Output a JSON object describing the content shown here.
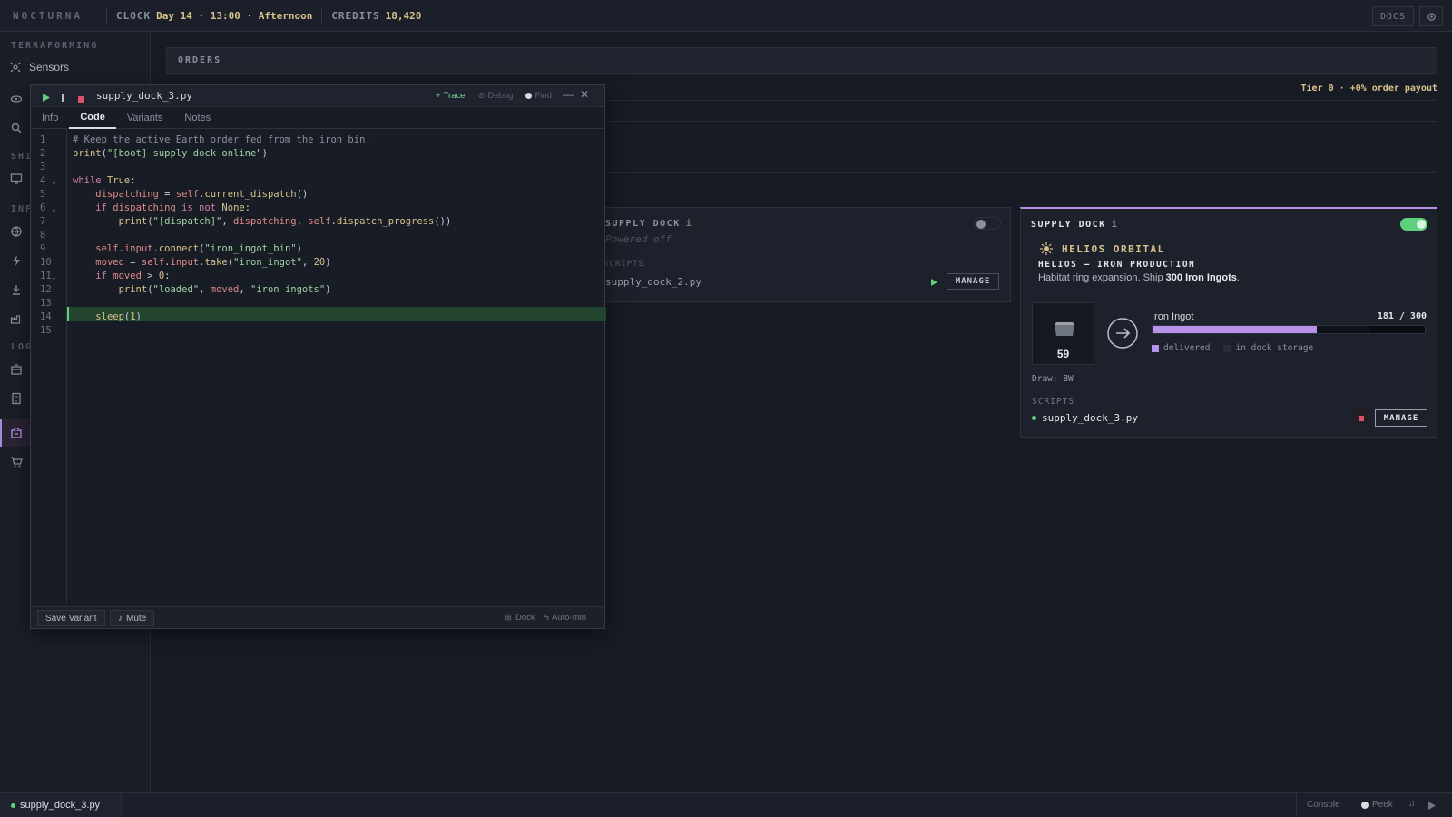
{
  "topbar": {
    "brand": "NOCTURNA",
    "clock_label": "CLOCK",
    "clock_value": "Day 14 · 13:00 · Afternoon",
    "credits_label": "CREDITS",
    "credits_value": "18,420",
    "docs_label": "DOCS",
    "settings_icon": "gear-icon"
  },
  "sidebar": {
    "section_terraforming": "TERRAFORMING",
    "sensors_label": "Sensors",
    "section_shi": "SHI",
    "section_inf": "INF",
    "section_log": "LOG"
  },
  "main": {
    "orders_title": "ORDERS",
    "tier_text": "Tier 0 · +0% order payout"
  },
  "dock_left": {
    "title": "SUPPLY DOCK",
    "status": "Powered off",
    "scripts_label": "SCRIPTS",
    "script_name": "supply_dock_2.py",
    "manage_label": "MANAGE"
  },
  "dock_right": {
    "title": "SUPPLY DOCK",
    "org_name": "HELIOS ORBITAL",
    "order_title": "HELIOS — IRON PRODUCTION",
    "order_desc_prefix": "Habitat ring expansion. Ship ",
    "order_desc_bold": "300 Iron Ingots",
    "order_desc_suffix": ".",
    "item_count": "59",
    "item_name": "Iron Ingot",
    "progress_text": "181 / 300",
    "progress_delivered": 181,
    "progress_total": 300,
    "legend_delivered": "delivered",
    "legend_storage": "in dock storage",
    "draw_text": "Draw: 8W",
    "scripts_label": "SCRIPTS",
    "script_name": "supply_dock_3.py",
    "manage_label": "MANAGE",
    "accent": "#b892e8",
    "toggle_on_color": "#5fd07e"
  },
  "editor": {
    "filename": "supply_dock_3.py",
    "trace_label": "Trace",
    "debug_label": "Debug",
    "find_label": "Find",
    "tabs": [
      "Info",
      "Code",
      "Variants",
      "Notes"
    ],
    "line_numbers": [
      "1",
      "2",
      "3",
      "4",
      "5",
      "6",
      "7",
      "8",
      "9",
      "10",
      "11",
      "12",
      "13",
      "14",
      "15"
    ],
    "save_variant_label": "Save Variant",
    "mute_label": "Mute",
    "dock_label": "Dock",
    "automin_label": "Auto-min"
  },
  "bottombar": {
    "script_tab": "supply_dock_3.py",
    "console_label": "Console",
    "peek_label": "Peek"
  }
}
